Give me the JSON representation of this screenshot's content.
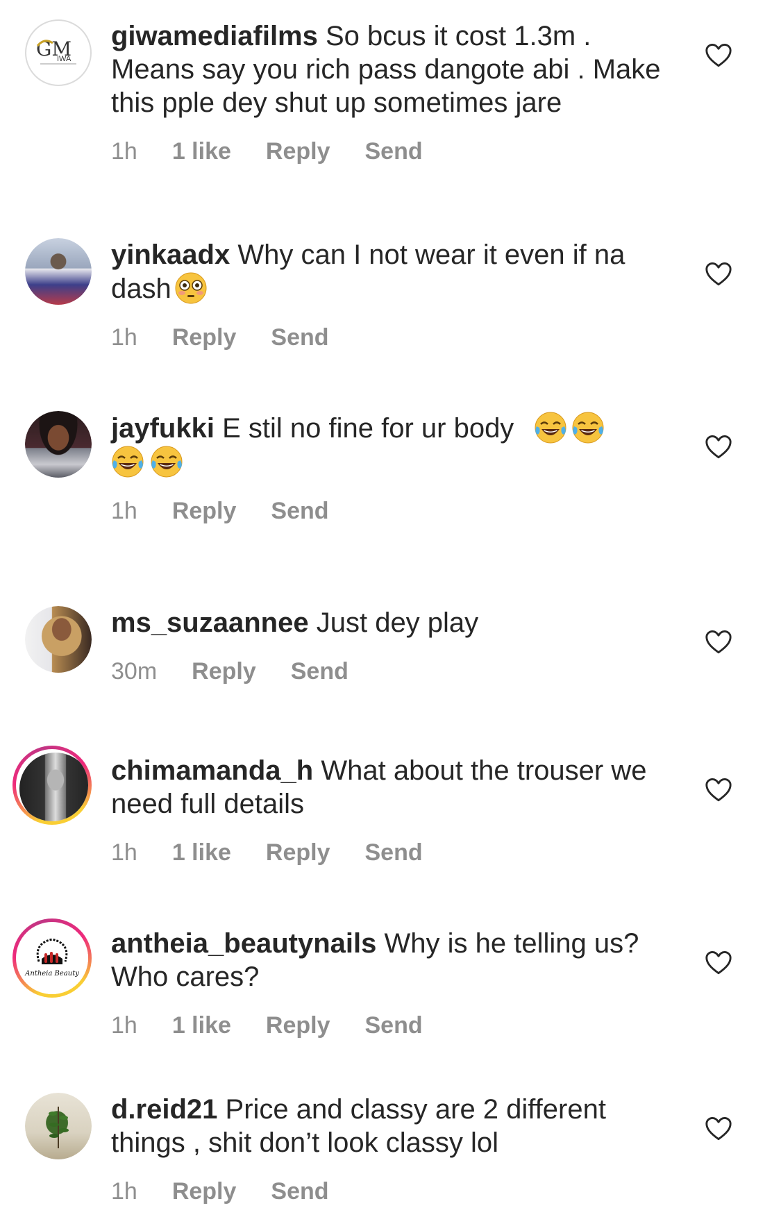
{
  "comments": [
    {
      "username": "giwamediafilms",
      "text": "So bcus it cost 1.3m . Means say you rich pass dangote abi . Make this pple dey shut up sometimes jare",
      "time": "1h",
      "likes": "1 like",
      "reply": "Reply",
      "send": "Send",
      "avatar_logo_main": "GM",
      "avatar_logo_sub": "IWA"
    },
    {
      "username": "yinkaadx",
      "text": "Why can I not wear it even if na dash",
      "emoji": [
        "flushed-face"
      ],
      "time": "1h",
      "reply": "Reply",
      "send": "Send"
    },
    {
      "username": "jayfukki",
      "text": "E stil no fine for ur body",
      "emoji": [
        "tears-of-joy",
        "tears-of-joy",
        "tears-of-joy",
        "tears-of-joy"
      ],
      "time": "1h",
      "reply": "Reply",
      "send": "Send"
    },
    {
      "username": "ms_suzaannee",
      "text": "Just dey play",
      "time": "30m",
      "reply": "Reply",
      "send": "Send"
    },
    {
      "username": "chimamanda_h",
      "text": "What about the trouser we need full details",
      "time": "1h",
      "likes": "1 like",
      "reply": "Reply",
      "send": "Send"
    },
    {
      "username": "antheia_beautynails",
      "text": "Why is he telling us? Who cares?",
      "time": "1h",
      "likes": "1 like",
      "reply": "Reply",
      "send": "Send",
      "avatar_logo_text": "Antheia Beauty"
    },
    {
      "username": "d.reid21",
      "text": "Price and classy are 2 different things , shit don’t look classy lol",
      "time": "1h",
      "reply": "Reply",
      "send": "Send"
    }
  ],
  "icons": {
    "like": "heart-outline-icon"
  },
  "colors": {
    "text": "#262626",
    "meta": "#8e8e8e",
    "story_ring_start": "#f9ce34",
    "story_ring_end": "#c13584"
  }
}
